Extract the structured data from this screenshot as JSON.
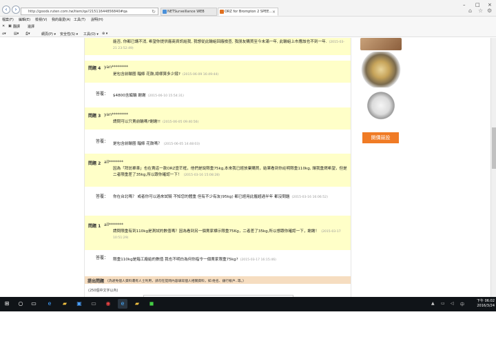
{
  "browser": {
    "url": "http://goods.ruten.com.tw/item/qa?21511644856840#qa",
    "tabs": [
      {
        "label": "NETSurveillance WEB"
      },
      {
        "label": "ORZ for Brompton 2 SPEE...",
        "active": true
      }
    ],
    "menu": [
      "檔案(F)",
      "編輯(E)",
      "檢視(V)",
      "我的最愛(A)",
      "工具(T)",
      "說明(H)"
    ],
    "favorites": [
      "翻譯",
      "邊譯"
    ],
    "commands": [
      "網頁(P) ▾",
      "安全性(S) ▾",
      "工具(O) ▾",
      "⊛ ▾"
    ]
  },
  "qa": {
    "top_fragment": {
      "text": "能否, 你都已講不消, 希望你提供廠商資訊給我, 我想從此輪組回廠檢查, 我朋友購買至今未滿一年, 此輪組上市應該也不到一年.",
      "date": "(2015-03-21 23:52:49)"
    },
    "items": [
      {
        "q_label": "問題",
        "q_num": "4",
        "user": "yan********",
        "question": "是包含前輪圈 輻條 花鼓,總様算多少錢?",
        "q_date": "(2015-06-09 16:49:44)",
        "a_label": "答覆：",
        "answer": "$4800含編輪 謝謝",
        "a_date": "(2015-06-10 15:54:31)"
      },
      {
        "q_label": "問題",
        "q_num": "3",
        "user": "yan********",
        "question": "請問可以只賣前輪嗎?謝謝!!",
        "q_date": "(2015-06-05 09:40:56)",
        "a_label": "答覆：",
        "answer": "是包含前輪圈 輻條 花鼓嗎？",
        "a_date": "(2015-06-05 14:48:03)"
      },
      {
        "q_label": "問題",
        "q_num": "2",
        "user": "all*******",
        "question": "因為「拜訪單車」也在賣這一款ORZ壹芒框，他們是說限重75kg,本來我已經放棄購買，結果看到你註明限重110kg, 讓我重燃希望，但是二者限重差了35kg,所以跟你確認一下！",
        "q_date": "(2015-03-16 15:08:28)",
        "a_label": "答覆：",
        "answer": "你在台北嗎？ 或者你可以過來試騎 不知您的體重 但有不少有友(95kg) 都已經用此握超過半年 都沒問題",
        "a_date": "(2015-03-16 16:06:52)"
      },
      {
        "q_label": "問題",
        "q_num": "1",
        "user": "all*******",
        "question": "請問限重有到110kg是測試的數值嗎？因為看到另一個賣家標示限重75Kg，二者差了35kg,所以想跟你確認一下，謝謝！",
        "q_date": "(2015-03-17 10:51:29)",
        "a_label": "答覆：",
        "answer": "限重110kg是箱工廠給的數值 我也不明白為何你指令一個賣家限重75kg?",
        "a_date": "(2015-03-17 16:15:46)"
      }
    ],
    "ask": {
      "title": "提出問題",
      "notice": "(為避免個人資料遭有人士利用，請勿在提問內容填寫個人相關資料，如:姓名、銀行帳戶..等。)",
      "limit": "(250個中文字以內)"
    }
  },
  "sidebar": {
    "bid_button": "開價競投"
  },
  "taskbar": {
    "time": "下午 06:02",
    "date": "2016/3/24"
  }
}
